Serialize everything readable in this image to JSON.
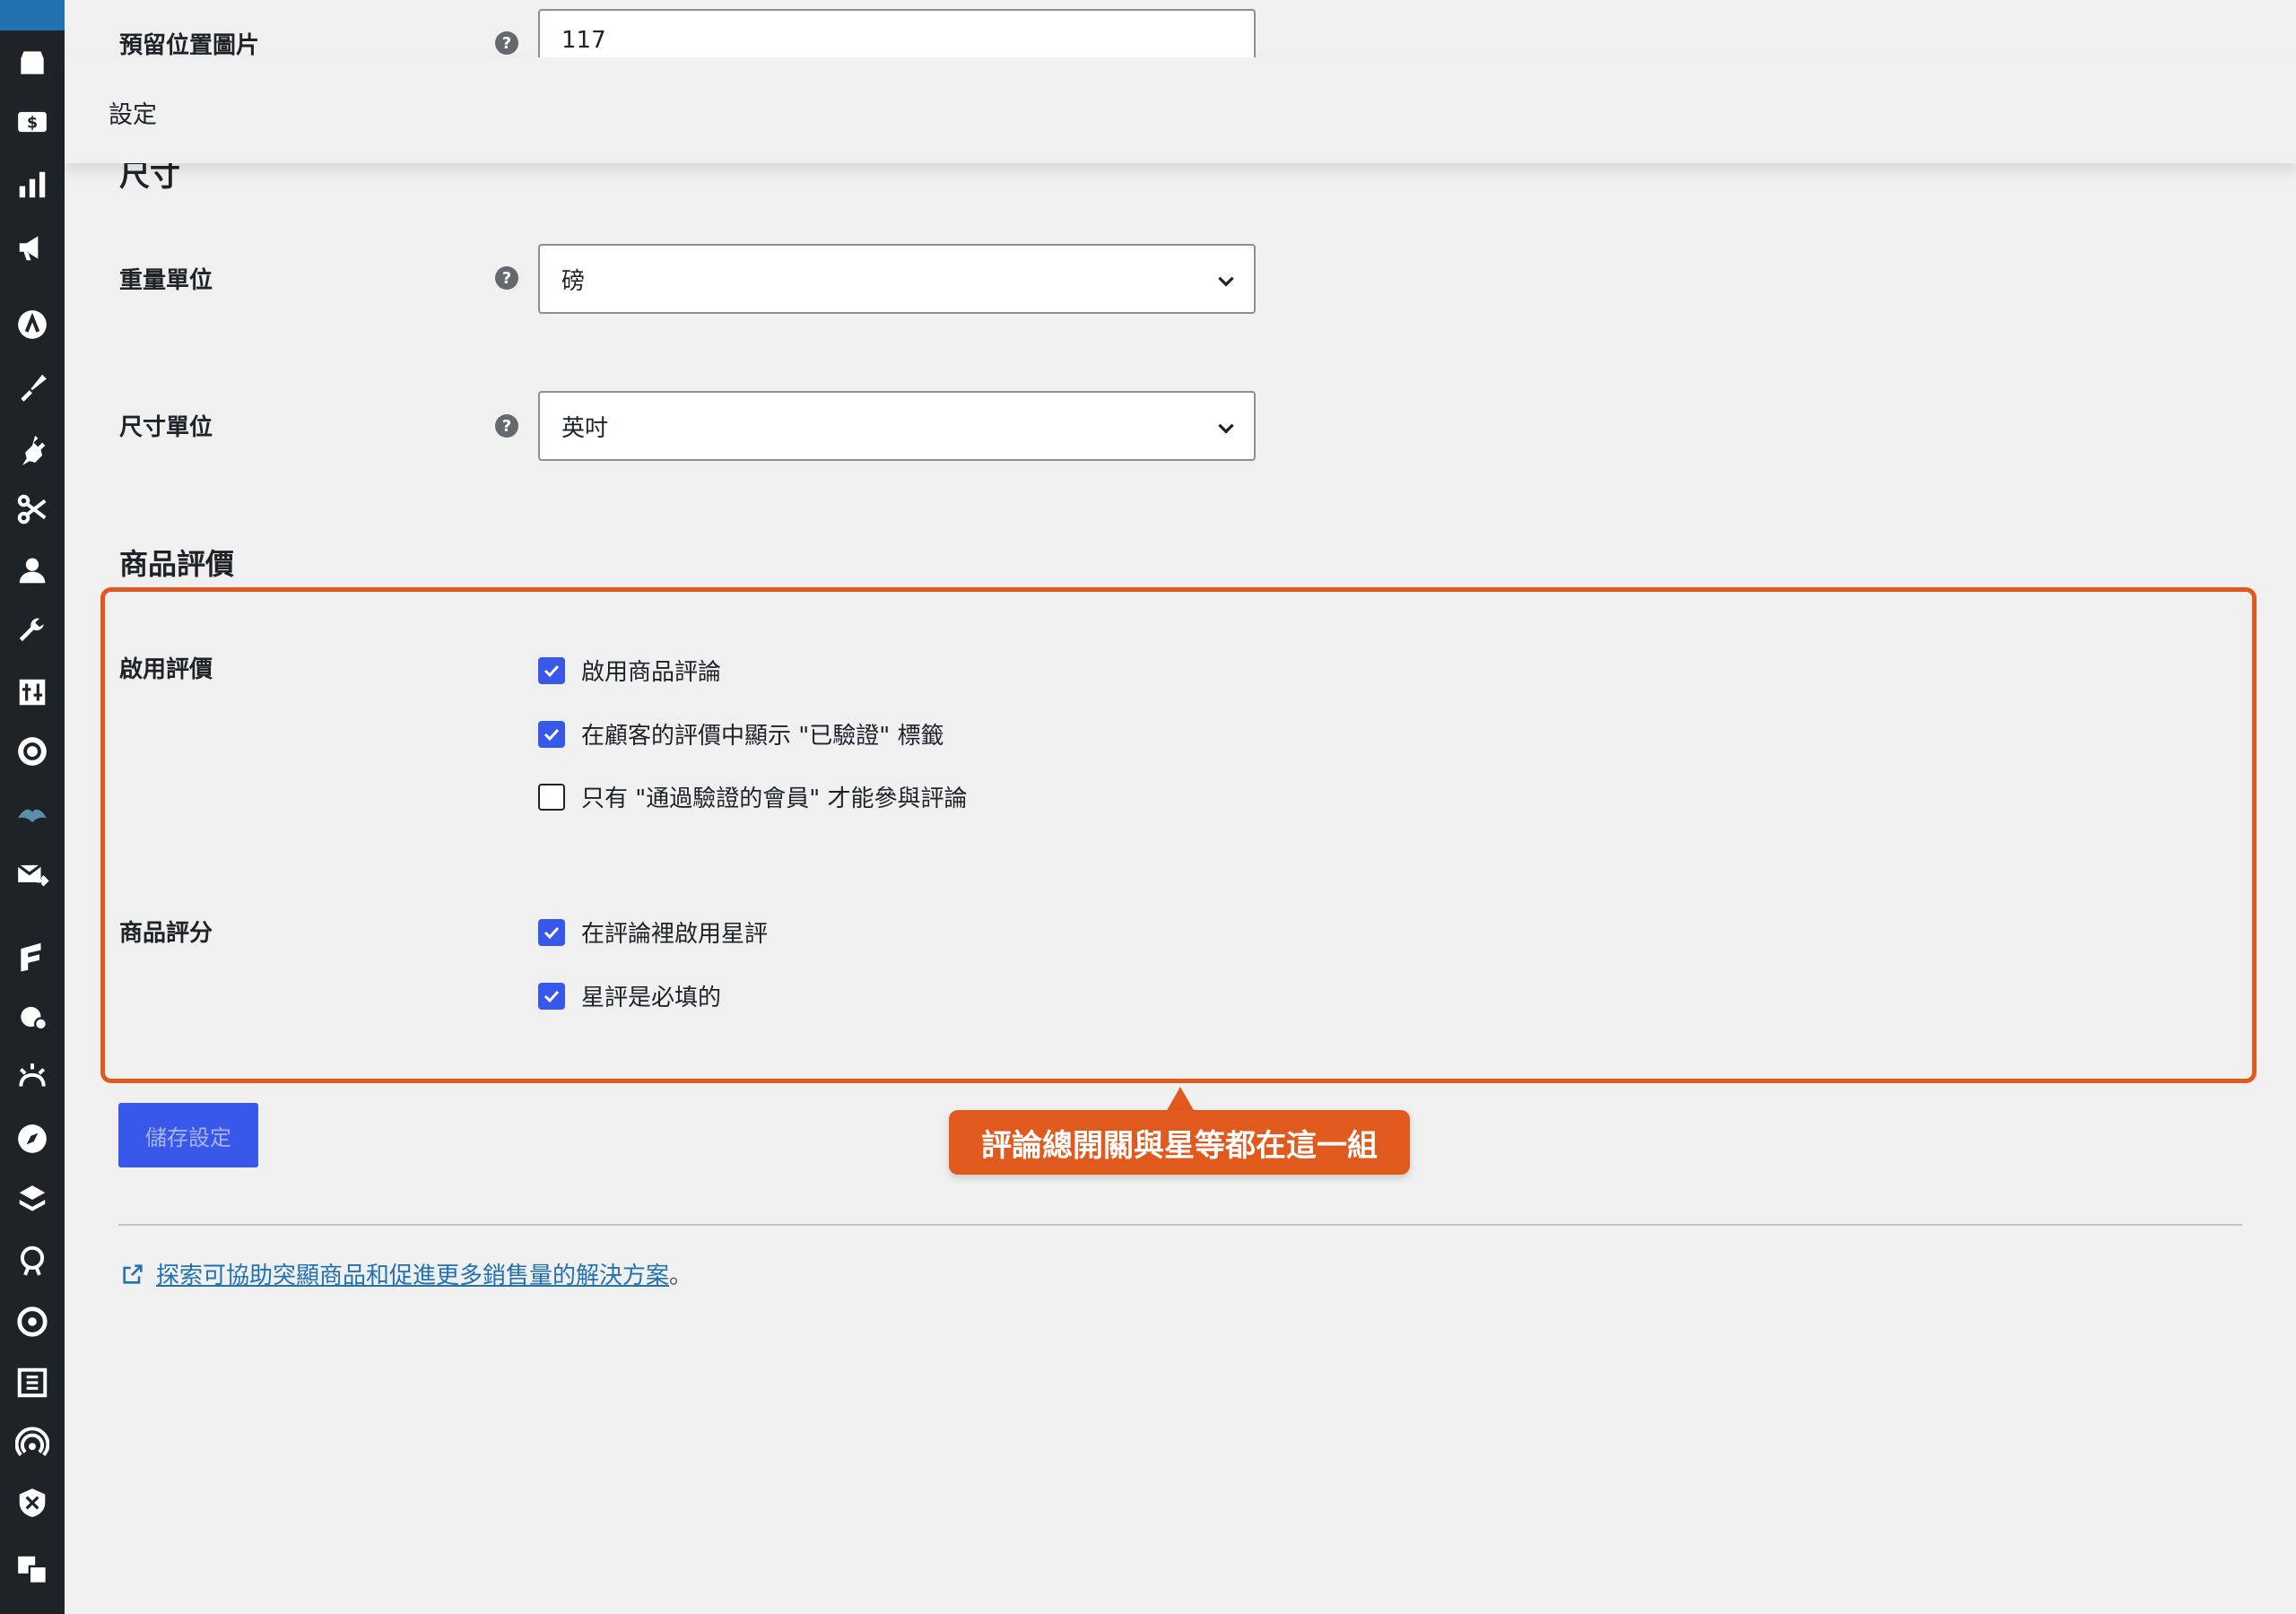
{
  "colors": {
    "accent": "#3858e9",
    "highlight": "#e15a1d",
    "link": "#2271b1",
    "sidebar": "#1d2327"
  },
  "sidebar": {
    "icons": [
      "woo-icon",
      "store-icon",
      "payments-icon",
      "analytics-icon",
      "marketing-icon",
      "astra-icon",
      "appearance-icon",
      "plugins-icon",
      "tools-scissors-icon",
      "users-icon",
      "wrench-icon",
      "settings-sliders-icon",
      "gear-badge-icon",
      "bird-icon",
      "mail-forward-icon",
      "forms-icon",
      "bug-gear-icon",
      "sun-icon",
      "compass-icon",
      "layers-icon",
      "brain-icon",
      "refresh-icon",
      "elementor-icon",
      "signal-icon",
      "shield-icon",
      "translate-icon"
    ]
  },
  "sticky_header": {
    "title": "設定"
  },
  "placeholder_row": {
    "label": "預留位置圖片",
    "value": "117"
  },
  "partial_section_title": "尺寸",
  "weight_row": {
    "label": "重量單位",
    "value": "磅"
  },
  "dimension_row": {
    "label": "尺寸單位",
    "value": "英吋"
  },
  "reviews_section": {
    "title": "商品評價",
    "enable_reviews": {
      "label": "啟用評價",
      "options": [
        {
          "label": "啟用商品評論",
          "checked": true
        },
        {
          "label": "在顧客的評價中顯示 \"已驗證\" 標籤",
          "checked": true
        },
        {
          "label": "只有 \"通過驗證的會員\" 才能參與評論",
          "checked": false
        }
      ]
    },
    "product_ratings": {
      "label": "商品評分",
      "options": [
        {
          "label": "在評論裡啟用星評",
          "checked": true
        },
        {
          "label": "星評是必填的",
          "checked": true
        }
      ]
    }
  },
  "save_button": "儲存設定",
  "callout": "評論總開關與星等都在這一組",
  "footer": {
    "link_text": "探索可協助突顯商品和促進更多銷售量的解決方案",
    "suffix": "。"
  }
}
